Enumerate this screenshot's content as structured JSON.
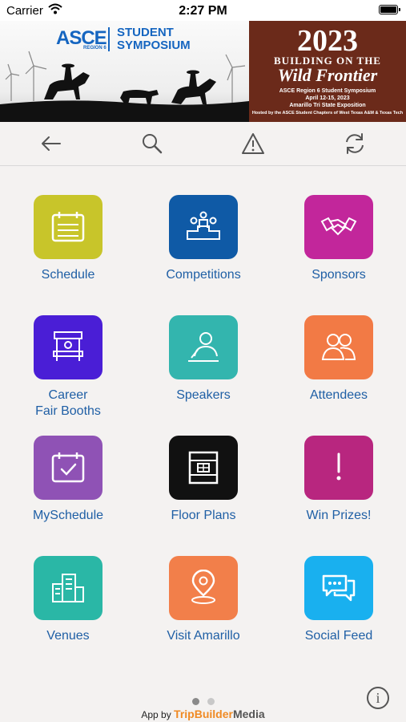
{
  "status_bar": {
    "carrier": "Carrier",
    "time": "2:27 PM"
  },
  "banner": {
    "asce": "ASCE",
    "region": "REGION 6",
    "symposium_line1": "STUDENT",
    "symposium_line2": "SYMPOSIUM",
    "year": "2023",
    "theme_line1": "BUILDING ON THE",
    "theme_line2": "Wild Frontier",
    "detail1": "ASCE Region 6 Student Symposium",
    "detail2": "April 12-15, 2023",
    "detail3": "Amarillo Tri State Exposition",
    "detail4": "Hosted by the ASCE Student Chapters of West Texas A&M & Texas Tech"
  },
  "toolbar": {
    "icons": [
      "back-arrow-icon",
      "search-icon",
      "alert-icon",
      "refresh-icon"
    ]
  },
  "menu": [
    {
      "label": "Schedule",
      "color": "#c8c52a",
      "icon": "calendar-icon"
    },
    {
      "label": "Competitions",
      "color": "#0f5aa6",
      "icon": "podium-icon"
    },
    {
      "label": "Sponsors",
      "color": "#c2269b",
      "icon": "handshake-icon"
    },
    {
      "label": "Career\nFair Booths",
      "color": "#4a1ed6",
      "icon": "booth-icon"
    },
    {
      "label": "Speakers",
      "color": "#33b5ae",
      "icon": "speaker-icon"
    },
    {
      "label": "Attendees",
      "color": "#f27a45",
      "icon": "people-icon"
    },
    {
      "label": "MySchedule",
      "color": "#8f52b5",
      "icon": "calendar-check-icon"
    },
    {
      "label": "Floor Plans",
      "color": "#111111",
      "icon": "floor-plan-icon"
    },
    {
      "label": "Win Prizes!",
      "color": "#b8267f",
      "icon": "exclamation-icon"
    },
    {
      "label": "Venues",
      "color": "#2ab7a6",
      "icon": "buildings-icon"
    },
    {
      "label": "Visit Amarillo",
      "color": "#f27f4a",
      "icon": "location-pin-icon"
    },
    {
      "label": "Social Feed",
      "color": "#19b0ef",
      "icon": "chat-bubbles-icon"
    }
  ],
  "pager": {
    "pages": 2,
    "active": 1
  },
  "footer": {
    "prefix": "App by",
    "brand1": "TripBuilder",
    "brand2": "Media"
  }
}
